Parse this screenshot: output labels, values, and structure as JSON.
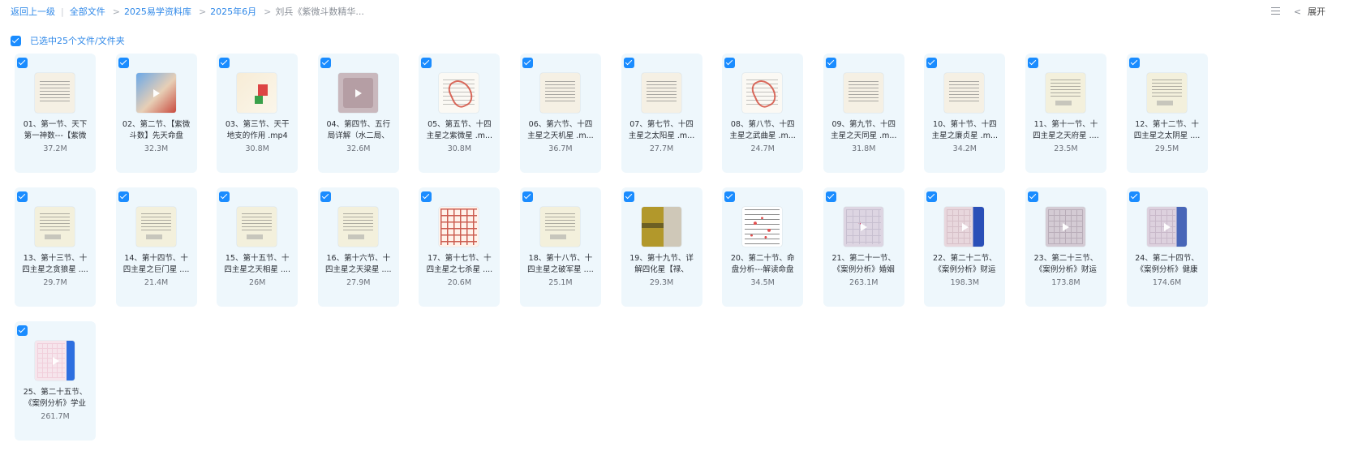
{
  "breadcrumb": {
    "back": "返回上一级",
    "all_files": "全部文件",
    "level1": "2025易学资料库",
    "level2": "2025年6月",
    "current": "刘兵《紫微斗数精华..."
  },
  "toolbar": {
    "expand_label": "展开"
  },
  "selection": {
    "label": "已选中25个文件/文件夹"
  },
  "files": [
    {
      "name": "01、第一节、天下第一神数---【紫微",
      "size": "37.2M",
      "thumb": "doc",
      "video": false
    },
    {
      "name": "02、第二节、【紫微斗数】先天命盘",
      "size": "32.3M",
      "thumb": "blue",
      "video": true
    },
    {
      "name": "03、第三节、天干地支的作用 .mp4",
      "size": "30.8M",
      "thumb": "mix",
      "video": false
    },
    {
      "name": "04、第四节、五行局详解（水二局、",
      "size": "32.6M",
      "thumb": "pink",
      "video": true
    },
    {
      "name": "05、第五节、十四主星之紫微星 .m...",
      "size": "30.8M",
      "thumb": "red",
      "video": false
    },
    {
      "name": "06、第六节、十四主星之天机星 .m...",
      "size": "36.7M",
      "thumb": "doc",
      "video": false
    },
    {
      "name": "07、第七节、十四主星之太阳星 .m...",
      "size": "27.7M",
      "thumb": "doc",
      "video": false
    },
    {
      "name": "08、第八节、十四主星之武曲星 .m...",
      "size": "24.7M",
      "thumb": "red",
      "video": false
    },
    {
      "name": "09、第九节、十四主星之天同星 .m...",
      "size": "31.8M",
      "thumb": "doc",
      "video": false
    },
    {
      "name": "10、第十节、十四主星之廉贞星 .m...",
      "size": "34.2M",
      "thumb": "doc",
      "video": false
    },
    {
      "name": "11、第十一节、十四主星之天府星 ....",
      "size": "23.5M",
      "thumb": "note",
      "video": false
    },
    {
      "name": "12、第十二节、十四主星之太阴星 ....",
      "size": "29.5M",
      "thumb": "note",
      "video": false
    },
    {
      "name": "13、第十三节、十四主星之贪狼星 ....",
      "size": "29.7M",
      "thumb": "note",
      "video": false
    },
    {
      "name": "14、第十四节、十四主星之巨门星 ....",
      "size": "21.4M",
      "thumb": "note",
      "video": false
    },
    {
      "name": "15、第十五节、十四主星之天相星 ....",
      "size": "26M",
      "thumb": "note",
      "video": false
    },
    {
      "name": "16、第十六节、十四主星之天梁星 ....",
      "size": "27.9M",
      "thumb": "note",
      "video": false
    },
    {
      "name": "17、第十七节、十四主星之七杀星 ....",
      "size": "20.6M",
      "thumb": "gridred",
      "video": false
    },
    {
      "name": "18、第十八节、十四主星之破军星 ....",
      "size": "25.1M",
      "thumb": "note",
      "video": false
    },
    {
      "name": "19、第十九节、详解四化星【禄、",
      "size": "29.3M",
      "thumb": "photo",
      "video": false
    },
    {
      "name": "20、第二十节、命盘分析---解读命盘",
      "size": "34.5M",
      "thumb": "scatter",
      "video": false
    },
    {
      "name": "21、第二十一节、《案例分析》婚姻",
      "size": "263.1M",
      "thumb": "chart1",
      "video": true
    },
    {
      "name": "22、第二十二节、《案例分析》财运",
      "size": "198.3M",
      "thumb": "chart2",
      "video": true
    },
    {
      "name": "23、第二十三节、《案例分析》财运",
      "size": "173.8M",
      "thumb": "chart3",
      "video": true
    },
    {
      "name": "24、第二十四节、《案例分析》健康",
      "size": "174.6M",
      "thumb": "chart4",
      "video": true
    },
    {
      "name": "25、第二十五节、《案例分析》学业",
      "size": "261.7M",
      "thumb": "chart5",
      "video": true
    }
  ]
}
